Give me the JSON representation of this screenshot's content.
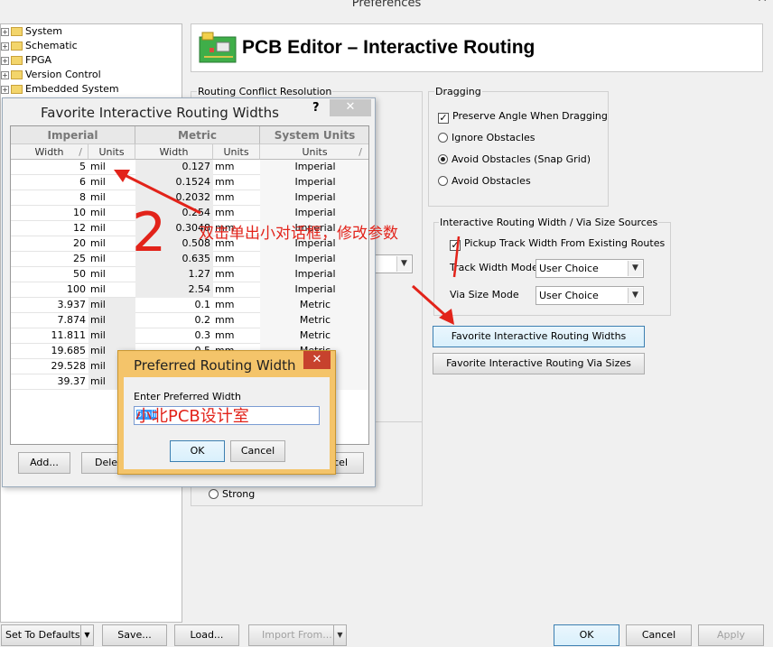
{
  "window": {
    "title": "Preferences",
    "close": "✕"
  },
  "tree": {
    "items": [
      "System",
      "Schematic",
      "FPGA",
      "Version Control",
      "Embedded System"
    ]
  },
  "header": {
    "title": "PCB Editor – Interactive Routing"
  },
  "conflict": {
    "title": "Routing Conflict Resolution",
    "strong_label": "Strong"
  },
  "dragging": {
    "title": "Dragging",
    "preserve_angle": "Preserve Angle When Dragging",
    "ignore": "Ignore Obstacles",
    "avoid_snap": "Avoid Obstacles (Snap Grid)",
    "avoid": "Avoid Obstacles"
  },
  "sources": {
    "title": "Interactive Routing Width / Via Size Sources",
    "pickup": "Pickup Track Width From Existing Routes",
    "track_label": "Track Width Mode",
    "track_value": "User Choice",
    "via_label": "Via Size Mode",
    "via_value": "User Choice"
  },
  "buttons": {
    "fav_widths": "Favorite Interactive Routing Widths",
    "fav_vias": "Favorite Interactive Routing Via Sizes",
    "set_defaults": "Set To Defaults",
    "save": "Save...",
    "load": "Load...",
    "import": "Import From...",
    "ok": "OK",
    "cancel": "Cancel",
    "apply": "Apply"
  },
  "fav_dialog": {
    "title": "Favorite Interactive Routing Widths",
    "help": "?",
    "close": "✕",
    "groups": [
      "Imperial",
      "Metric",
      "System Units"
    ],
    "columns": [
      "Width",
      "Units",
      "Width",
      "Units",
      "Units"
    ],
    "sort_glyph": "/",
    "rows": [
      [
        "5",
        "mil",
        "0.127",
        "mm",
        "Imperial"
      ],
      [
        "6",
        "mil",
        "0.1524",
        "mm",
        "Imperial"
      ],
      [
        "8",
        "mil",
        "0.2032",
        "mm",
        "Imperial"
      ],
      [
        "10",
        "mil",
        "0.254",
        "mm",
        "Imperial"
      ],
      [
        "12",
        "mil",
        "0.3048",
        "mm",
        "Imperial"
      ],
      [
        "20",
        "mil",
        "0.508",
        "mm",
        "Imperial"
      ],
      [
        "25",
        "mil",
        "0.635",
        "mm",
        "Imperial"
      ],
      [
        "50",
        "mil",
        "1.27",
        "mm",
        "Imperial"
      ],
      [
        "100",
        "mil",
        "2.54",
        "mm",
        "Imperial"
      ],
      [
        "3.937",
        "mil",
        "0.1",
        "mm",
        "Metric"
      ],
      [
        "7.874",
        "mil",
        "0.2",
        "mm",
        "Metric"
      ],
      [
        "11.811",
        "mil",
        "0.3",
        "mm",
        "Metric"
      ],
      [
        "19.685",
        "mil",
        "0.5",
        "mm",
        "Metric"
      ],
      [
        "29.528",
        "mil",
        "",
        "",
        ""
      ],
      [
        "39.37",
        "mil",
        "",
        "",
        ""
      ]
    ],
    "add": "Add...",
    "delete": "Delete",
    "cancel_partial": "ncel"
  },
  "pref_dialog": {
    "title": "Preferred Routing Width",
    "close": "✕",
    "label": "Enter Preferred Width",
    "input_value": "5mil",
    "ok": "OK",
    "cancel": "Cancel"
  },
  "annotations": {
    "number": "2",
    "note": "双击单出小对话框，修改参数",
    "watermark": "小北PCB设计室"
  },
  "colors": {
    "annotation": "#e2231a"
  }
}
